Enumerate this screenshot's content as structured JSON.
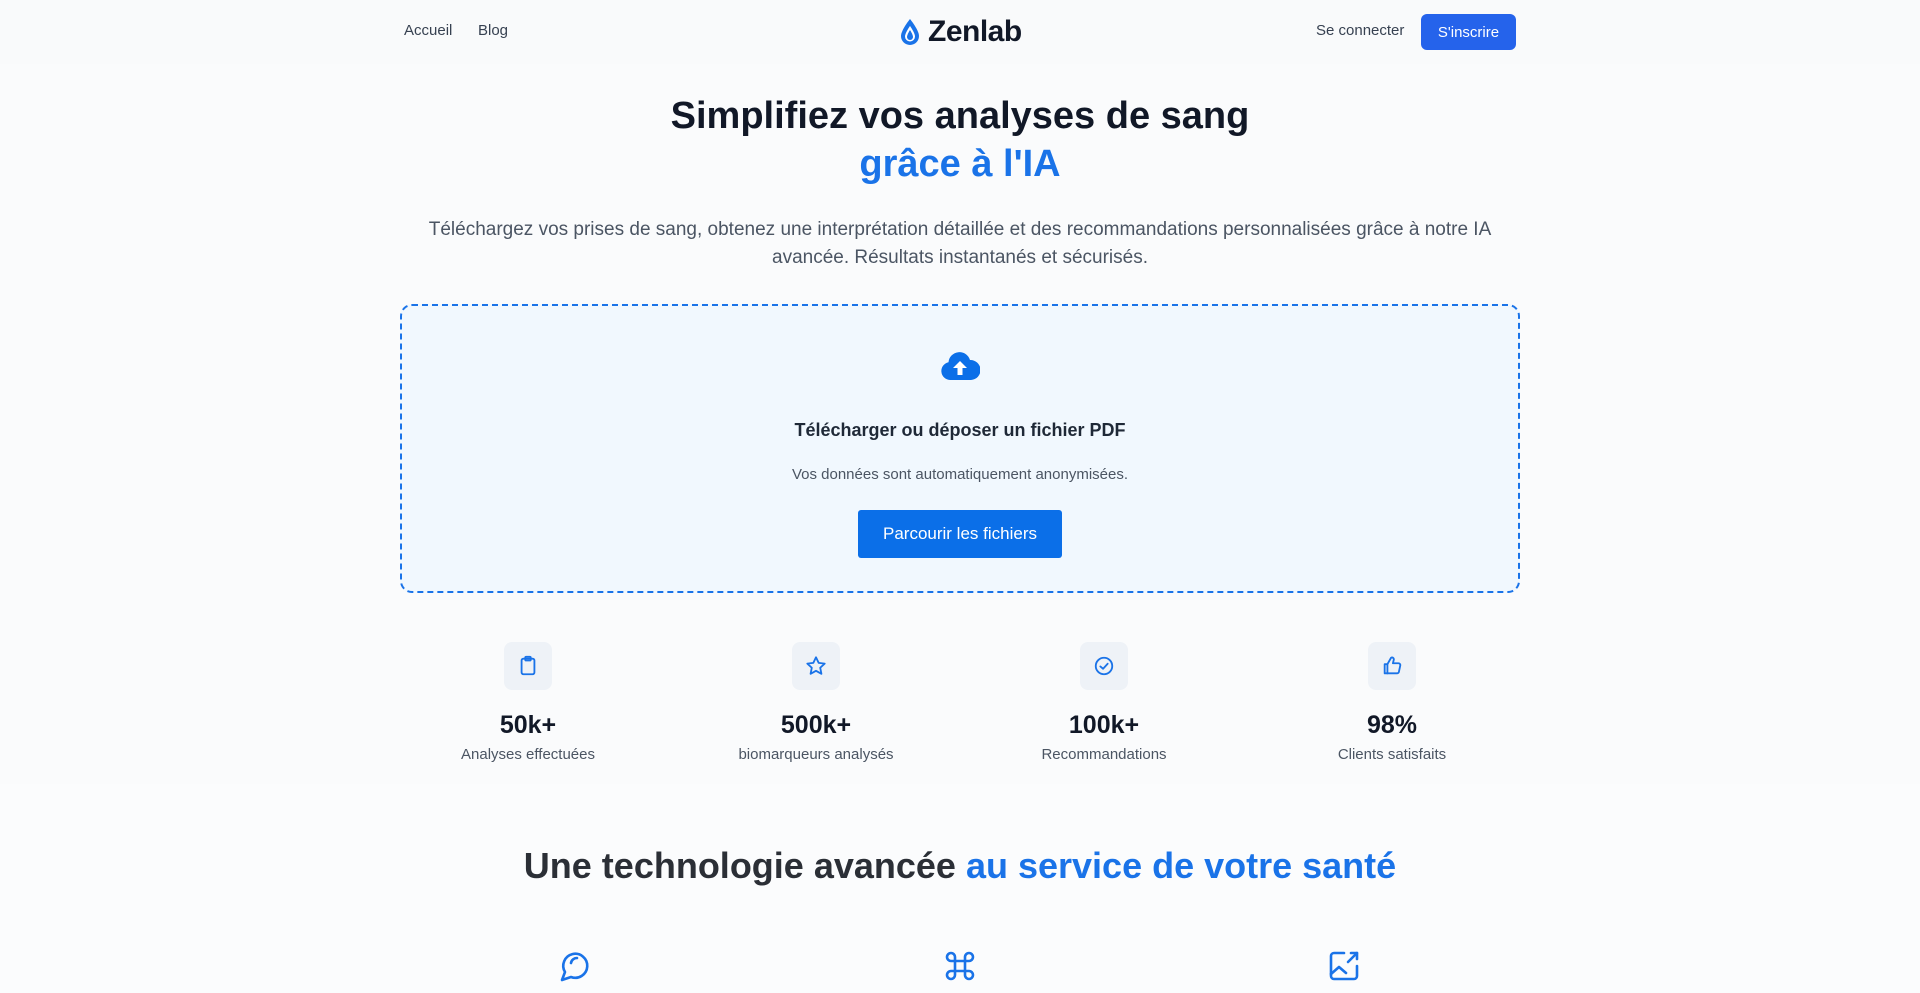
{
  "nav": {
    "links": [
      {
        "label": "Accueil"
      },
      {
        "label": "Blog"
      }
    ],
    "brand": "Zenlab",
    "login_label": "Se connecter",
    "signup_label": "S'inscrire"
  },
  "hero": {
    "title": "Simplifiez vos analyses de sang",
    "title_accent": "grâce à l'IA",
    "subtitle": "Téléchargez vos prises de sang, obtenez une interprétation détaillée et des recommandations personnalisées grâce à notre IA avancée. Résultats instantanés et sécurisés."
  },
  "upload": {
    "icon": "cloud-upload-icon",
    "title": "Télécharger ou déposer un fichier PDF",
    "note": "Vos données sont automatiquement anonymisées.",
    "button_label": "Parcourir les fichiers"
  },
  "stats": [
    {
      "icon": "clipboard-icon",
      "value": "50k+",
      "label": "Analyses effectuées"
    },
    {
      "icon": "star-icon",
      "value": "500k+",
      "label": "biomarqueurs analysés"
    },
    {
      "icon": "check-circle-icon",
      "value": "100k+",
      "label": "Recommandations"
    },
    {
      "icon": "thumbs-up-icon",
      "value": "98%",
      "label": "Clients satisfaits"
    }
  ],
  "features_section": {
    "title": "Une technologie avancée",
    "title_accent": "au service de votre santé",
    "icons": [
      "chat-bubble-icon",
      "command-icon",
      "image-edit-icon"
    ]
  },
  "colors": {
    "primary": "#1a73e8",
    "button": "#2563eb",
    "upload_bg": "#f1f8fe"
  }
}
